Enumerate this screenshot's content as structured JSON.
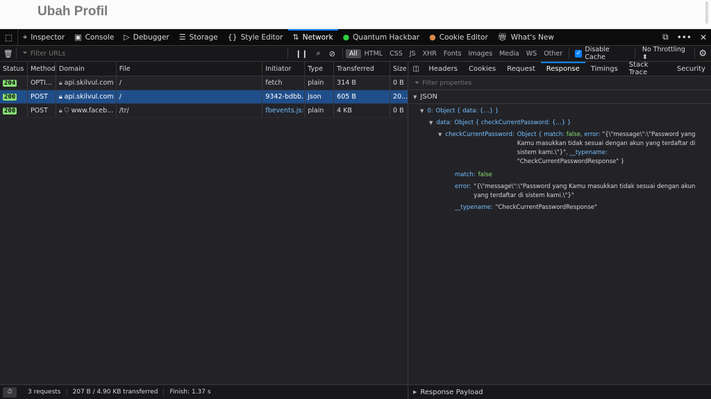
{
  "page": {
    "title": "Ubah Profil"
  },
  "toolbox": {
    "tabs": [
      {
        "label": "Inspector",
        "icon": "inspector-icon",
        "active": false
      },
      {
        "label": "Console",
        "icon": "console-icon",
        "active": false
      },
      {
        "label": "Debugger",
        "icon": "debugger-icon",
        "active": false
      },
      {
        "label": "Storage",
        "icon": "storage-icon",
        "active": false
      },
      {
        "label": "Style Editor",
        "icon": "style-editor-icon",
        "active": false
      },
      {
        "label": "Network",
        "icon": "network-icon",
        "active": true
      },
      {
        "label": "Quantum Hackbar",
        "icon": "hackbar-icon",
        "active": false
      },
      {
        "label": "Cookie Editor",
        "icon": "cookie-icon",
        "active": false
      },
      {
        "label": "What's New",
        "icon": "gift-icon",
        "active": false
      }
    ]
  },
  "netbar": {
    "filter_placeholder": "Filter URLs",
    "type_filters": [
      "All",
      "HTML",
      "CSS",
      "JS",
      "XHR",
      "Fonts",
      "Images",
      "Media",
      "WS",
      "Other"
    ],
    "active_filter": "All",
    "disable_cache_label": "Disable Cache",
    "disable_cache_checked": true,
    "throttling": "No Throttling"
  },
  "requests": {
    "columns": [
      "Status",
      "Method",
      "Domain",
      "File",
      "Initiator",
      "Type",
      "Transferred",
      "Size"
    ],
    "rows": [
      {
        "status": "204",
        "method": "OPTI...",
        "domain": "api.skilvul.com",
        "file": "/",
        "initiator": "fetch",
        "type": "plain",
        "transferred": "314 B",
        "size": "0 B",
        "selected": false,
        "tracker": false
      },
      {
        "status": "200",
        "method": "POST",
        "domain": "api.skilvul.com",
        "file": "/",
        "initiator": "9342-bdbb...",
        "type": "json",
        "transferred": "605 B",
        "size": "20...",
        "selected": true,
        "tracker": false
      },
      {
        "status": "200",
        "method": "POST",
        "domain": "www.faceb...",
        "file": "/tr/",
        "initiator": "fbevents.js:...",
        "type": "plain",
        "transferred": "4 KB",
        "size": "0 B",
        "selected": false,
        "tracker": true
      }
    ]
  },
  "statusbar": {
    "requests": "3 requests",
    "transferred": "207 B / 4.90 KB transferred",
    "finish": "Finish: 1.37 s"
  },
  "detail": {
    "tabs": [
      "Headers",
      "Cookies",
      "Request",
      "Response",
      "Timings",
      "Stack Trace",
      "Security"
    ],
    "active_tab": "Response",
    "filter_placeholder": "Filter properties",
    "json_label": "JSON",
    "tree": {
      "root_key": "0:",
      "root_val": "Object { data: {…} }",
      "data_key": "data:",
      "data_val": "Object { checkCurrentPassword: {…} }",
      "ccp_key": "checkCurrentPassword:",
      "ccp_val_prefix": "Object { match: ",
      "ccp_val_false": "false",
      "ccp_val_mid": ", error: ",
      "ccp_val_error": "\"{\\\"message\\\":\\\"Password yang Kamu masukkan tidak sesuai dengan akun yang terdaftar di sistem kami.\\\"}\"",
      "ccp_val_typename_key": ", __typename: ",
      "ccp_val_typename": "\"CheckCurrentPasswordResponse\" }",
      "match_key": "match:",
      "match_val": "false",
      "error_key": "error:",
      "error_val": "\"{\\\"message\\\":\\\"Password yang Kamu masukkan tidak sesuai dengan akun yang terdaftar di sistem kami.\\\"}\"",
      "typename_key": "__typename:",
      "typename_val": "\"CheckCurrentPasswordResponse\""
    },
    "payload_label": "Response Payload"
  }
}
